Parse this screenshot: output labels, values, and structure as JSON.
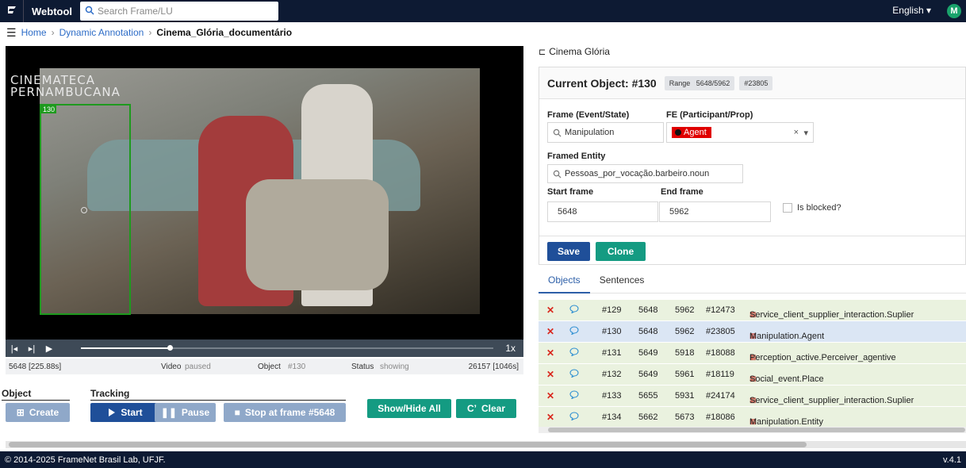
{
  "topbar": {
    "app_name": "Webtool",
    "search_placeholder": "Search Frame/LU",
    "language": "English",
    "avatar_initial": "M"
  },
  "breadcrumb": {
    "home": "Home",
    "section": "Dynamic Annotation",
    "current": "Cinema_Glória_documentário"
  },
  "video": {
    "watermark_line1": "CINEMATECA",
    "watermark_line2": "PERNAMBUCANA",
    "bbox_label": "130",
    "speed": "1x",
    "progress_fraction": 0.215,
    "status": {
      "frame_start": "5648 [225.88s]",
      "video_label": "Video",
      "video_value": "paused",
      "object_label": "Object",
      "object_value": "#130",
      "status_label": "Status",
      "status_value": "showing",
      "frame_end": "26157 [1046s]"
    }
  },
  "object_section": {
    "title": "Object",
    "create_label": "Create"
  },
  "tracking_section": {
    "title": "Tracking",
    "start_label": "Start",
    "pause_label": "Pause",
    "stop_label": "Stop at frame #5648"
  },
  "actions": {
    "show_hide_label": "Show/Hide All",
    "clear_label": "Clear"
  },
  "panel": {
    "document_title": "Cinema Glória",
    "current_object": "Current Object: #130",
    "range_label": "Range",
    "range_value": "5648/5962",
    "id_tag": "#23805",
    "frame_label": "Frame (Event/State)",
    "frame_value": "Manipulation",
    "fe_label": "FE (Participant/Prop)",
    "fe_value": "Agent",
    "framed_entity_label": "Framed Entity",
    "framed_entity_value": "Pessoas_por_vocação.barbeiro.noun",
    "start_frame_label": "Start frame",
    "start_frame_value": "5648",
    "end_frame_label": "End frame",
    "end_frame_value": "5962",
    "blocked_label": "Is blocked?",
    "save_label": "Save",
    "clone_label": "Clone"
  },
  "tabs": [
    "Objects",
    "Sentences"
  ],
  "objects": [
    {
      "id": "#129",
      "start": "5648",
      "end": "5962",
      "ref": "#12473",
      "fe": "Service_client_supplier_interaction.Suplier",
      "state": "green"
    },
    {
      "id": "#130",
      "start": "5648",
      "end": "5962",
      "ref": "#23805",
      "fe": "Manipulation.Agent",
      "state": "blue"
    },
    {
      "id": "#131",
      "start": "5649",
      "end": "5918",
      "ref": "#18088",
      "fe": "Perception_active.Perceiver_agentive",
      "state": "green"
    },
    {
      "id": "#132",
      "start": "5649",
      "end": "5961",
      "ref": "#18119",
      "fe": "Social_event.Place",
      "state": "green"
    },
    {
      "id": "#133",
      "start": "5655",
      "end": "5931",
      "ref": "#24174",
      "fe": "Service_client_supplier_interaction.Suplier",
      "state": "green"
    },
    {
      "id": "#134",
      "start": "5662",
      "end": "5673",
      "ref": "#18086",
      "fe": "Manipulation.Entity",
      "state": "green"
    }
  ],
  "footer": {
    "copyright": "© 2014-2025 FrameNet Brasil Lab, UFJF.",
    "version": "v.4.1"
  }
}
